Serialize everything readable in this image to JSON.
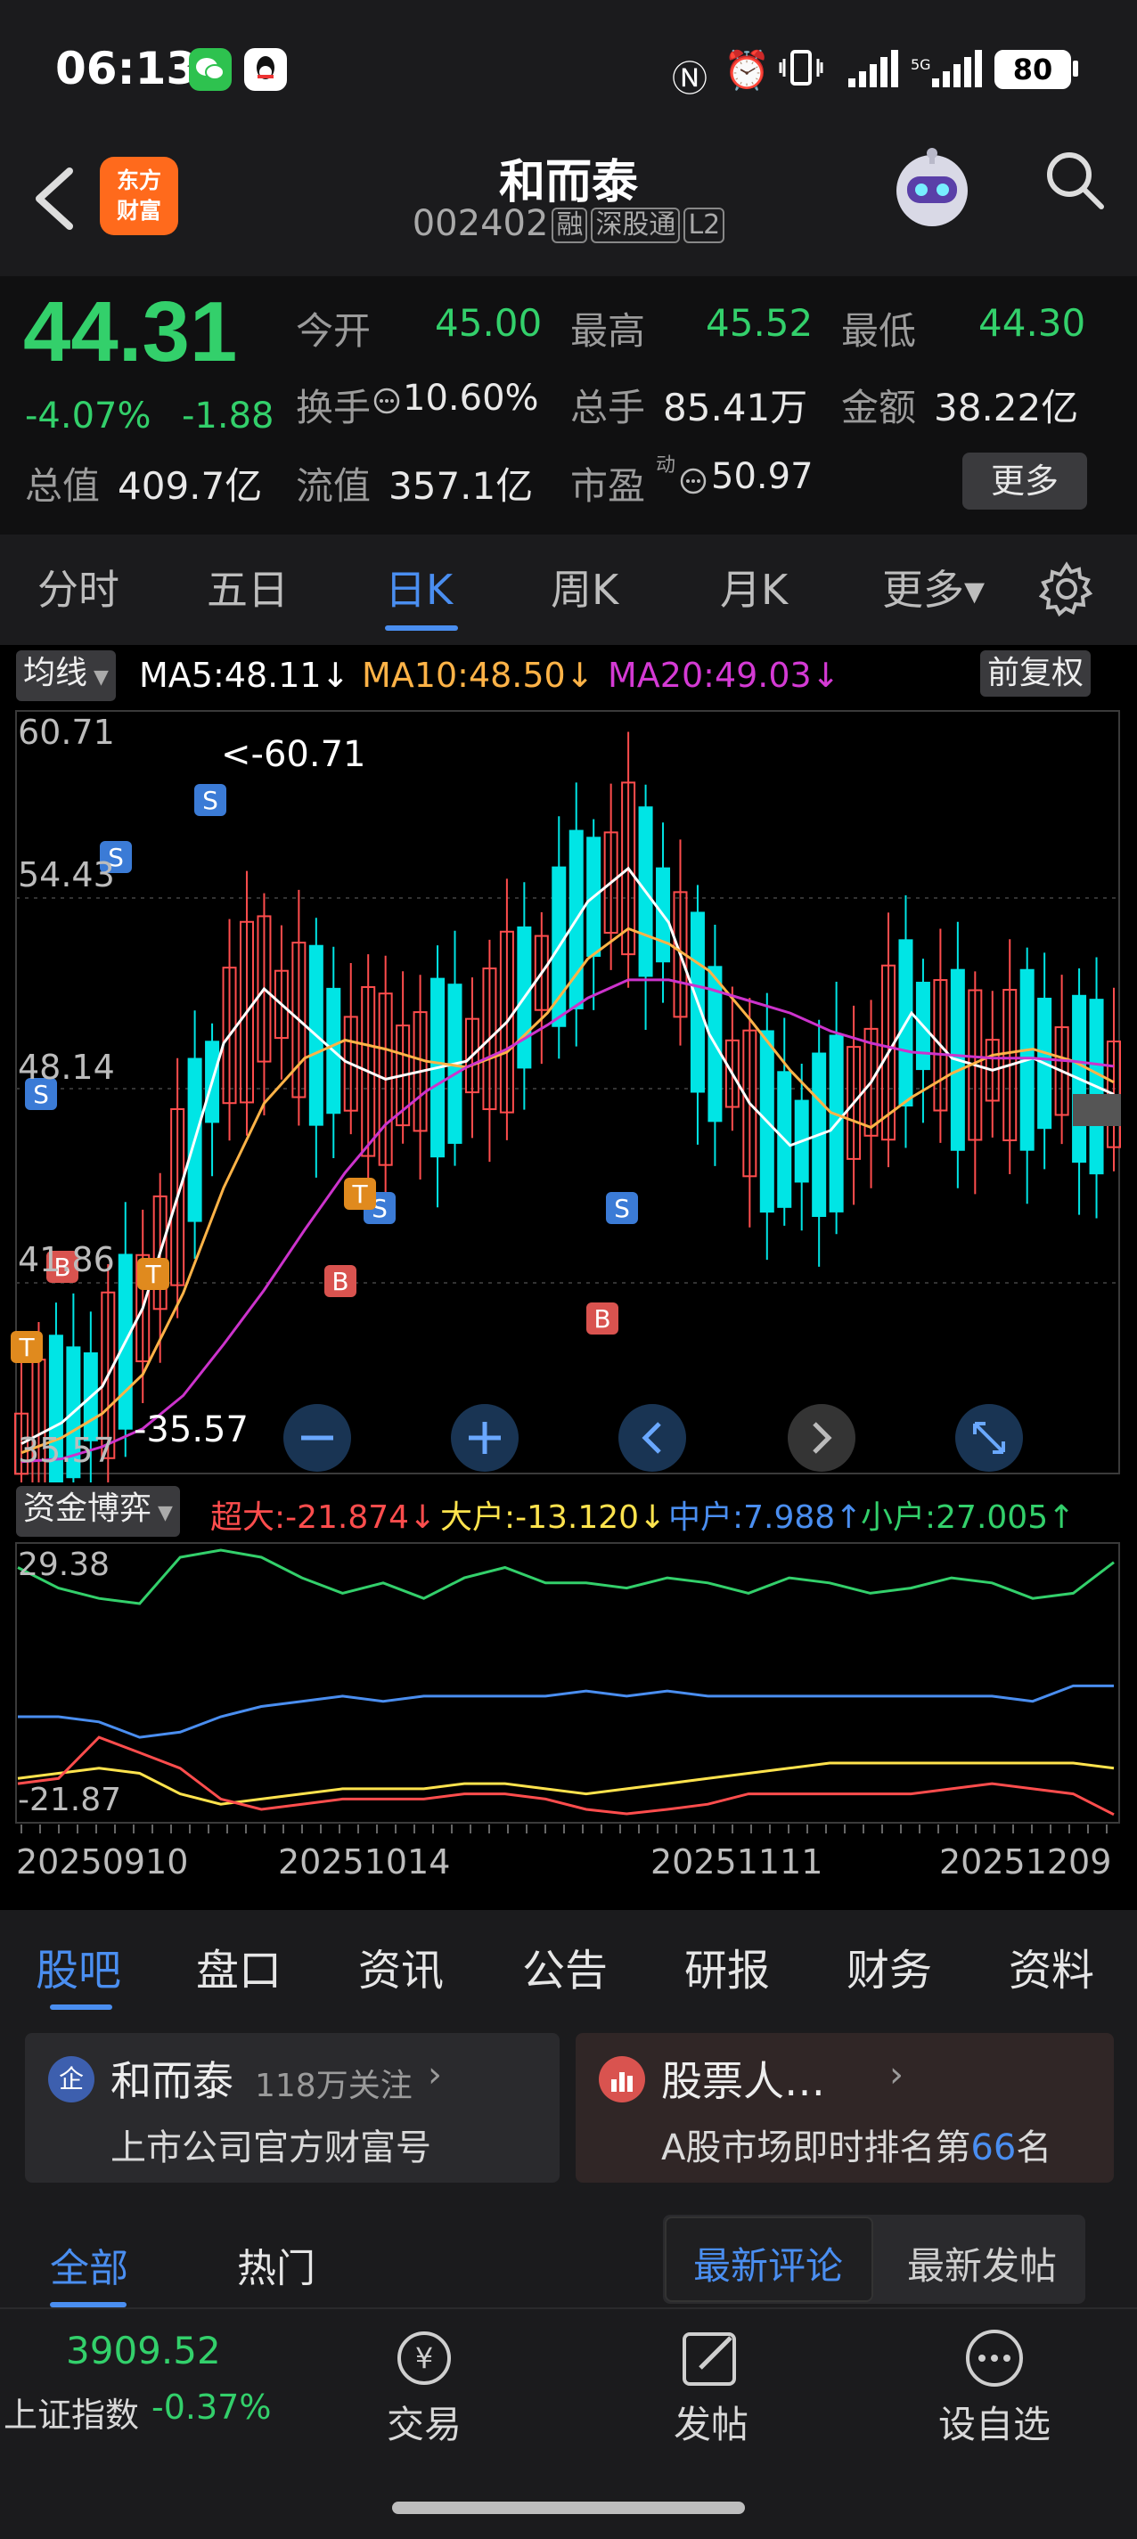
{
  "status_bar": {
    "time": "06:13",
    "battery": "80"
  },
  "header": {
    "logo_text": [
      "东方",
      "财富"
    ],
    "stock_name": "和而泰",
    "stock_code": "002402",
    "tags": [
      "融",
      "深股通",
      "L2"
    ]
  },
  "quote": {
    "price": "44.31",
    "change_pct": "-4.07%",
    "change_amt": "-1.88",
    "open_label": "今开",
    "open": "45.00",
    "high_label": "最高",
    "high": "45.52",
    "low_label": "最低",
    "low": "44.30",
    "turnover_label": "换手",
    "turnover": "10.60%",
    "volume_label": "总手",
    "volume": "85.41万",
    "amount_label": "金额",
    "amount": "38.22亿",
    "mktcap_label": "总值",
    "mktcap": "409.7亿",
    "float_label": "流值",
    "float_cap": "357.1亿",
    "pe_label": "市盈",
    "pe_sup": "动",
    "pe": "50.97",
    "more_button": "更多"
  },
  "chart_tabs": [
    "分时",
    "五日",
    "日K",
    "周K",
    "月K",
    "更多▾"
  ],
  "active_chart_tab": "日K",
  "ma_row": {
    "dropdown": "均线",
    "ma5": "MA5:48.11↓",
    "ma10": "MA10:48.50↓",
    "ma20": "MA20:49.03↓",
    "adjust": "前复权"
  },
  "kline_labels": {
    "y_ticks": [
      "60.71",
      "54.43",
      "48.14",
      "41.86",
      "35.57"
    ],
    "max_marker": "<-60.71",
    "min_marker": "-35.57"
  },
  "flow_row": {
    "dropdown": "资金博弈",
    "super": "超大:-21.874↓",
    "large": "大户:-13.120↓",
    "medium": "中户:7.988↑",
    "small": "小户:27.005↑"
  },
  "flow_labels": {
    "top": "29.38",
    "bottom": "-21.87"
  },
  "dates": [
    "20250910",
    "20251014",
    "20251111",
    "20251209"
  ],
  "colors": {
    "up": "#ff4d4d",
    "down": "#00e5e5",
    "ma5": "#ffffff",
    "ma10": "#ffb347",
    "ma20": "#cc33cc",
    "accent": "#4a8ef0"
  },
  "chart_data": [
    {
      "type": "line",
      "title": "",
      "series": [
        {
          "name": "MA5",
          "values": [
            36.5,
            37.2,
            38.4,
            41.0,
            45.3,
            49.8,
            51.6,
            50.4,
            49.2,
            48.6,
            48.9,
            49.2,
            50.5,
            52.4,
            54.5,
            55.6,
            53.8,
            50.1,
            47.8,
            46.4,
            46.9,
            48.5,
            50.8,
            49.3,
            48.9,
            49.3,
            48.7,
            48.1
          ]
        },
        {
          "name": "MA10",
          "values": [
            36.2,
            36.7,
            37.5,
            38.8,
            41.5,
            45.0,
            47.8,
            49.3,
            49.9,
            49.6,
            49.2,
            49.0,
            49.5,
            50.8,
            52.6,
            53.6,
            53.1,
            52.2,
            50.6,
            48.9,
            47.5,
            47.0,
            48.0,
            48.8,
            49.4,
            49.6,
            49.2,
            48.5
          ]
        },
        {
          "name": "MA20",
          "values": [
            35.9,
            36.0,
            36.4,
            37.0,
            38.1,
            39.8,
            41.6,
            43.6,
            45.5,
            47.1,
            48.2,
            49.0,
            49.6,
            50.4,
            51.3,
            51.9,
            51.9,
            51.6,
            51.2,
            50.8,
            50.2,
            49.8,
            49.5,
            49.4,
            49.3,
            49.3,
            49.2,
            49.03
          ]
        }
      ],
      "ylim": [
        35.57,
        60.71
      ]
    },
    {
      "type": "line",
      "title": "",
      "series": [
        {
          "name": "小户",
          "values": [
            26,
            22,
            20,
            19,
            28,
            29.38,
            28,
            24,
            21,
            23,
            20,
            24,
            26,
            23,
            23,
            22,
            24,
            23,
            21,
            24,
            23,
            21,
            22,
            24,
            23,
            20,
            21,
            27
          ]
        },
        {
          "name": "中户",
          "values": [
            -3,
            -3,
            -4,
            -7,
            -6,
            -3,
            -1,
            0,
            1,
            0,
            1,
            1,
            1,
            1,
            2,
            1,
            2,
            1,
            1,
            1,
            1,
            1,
            1,
            1,
            1,
            0,
            3,
            3
          ]
        },
        {
          "name": "大户",
          "values": [
            -15,
            -14,
            -13,
            -14,
            -18,
            -20,
            -19,
            -18,
            -17,
            -17,
            -17,
            -16,
            -16,
            -17,
            -18,
            -17,
            -16,
            -15,
            -14,
            -13,
            -12,
            -12,
            -12,
            -12,
            -12,
            -12,
            -12,
            -13
          ]
        },
        {
          "name": "超大",
          "values": [
            -16,
            -15,
            -7,
            -10,
            -13,
            -19,
            -21,
            -20,
            -19,
            -19,
            -19,
            -18,
            -18,
            -19,
            -21,
            -21.87,
            -21,
            -20,
            -18,
            -18,
            -18,
            -18,
            -18,
            -17,
            -16,
            -17,
            -18,
            -22
          ]
        }
      ],
      "ylim": [
        -21.87,
        29.38
      ]
    }
  ],
  "bottom_tabs": [
    "股吧",
    "盘口",
    "资讯",
    "公告",
    "研报",
    "财务",
    "资料"
  ],
  "cards": {
    "left_title": "和而泰",
    "left_followers": "118万关注",
    "left_sub": "上市公司官方财富号",
    "right_title": "股票人…",
    "right_sub_pre": "A股市场即时排名第",
    "right_rank": "66",
    "right_sub_post": "名"
  },
  "filters": {
    "all": "全部",
    "hot": "热门",
    "latest_comment": "最新评论",
    "latest_post": "最新发帖"
  },
  "bottom_nav": {
    "index_value": "3909.52",
    "index_label": "上证指数",
    "index_change": "-0.37%",
    "trade": "交易",
    "post": "发帖",
    "watch": "设自选"
  }
}
